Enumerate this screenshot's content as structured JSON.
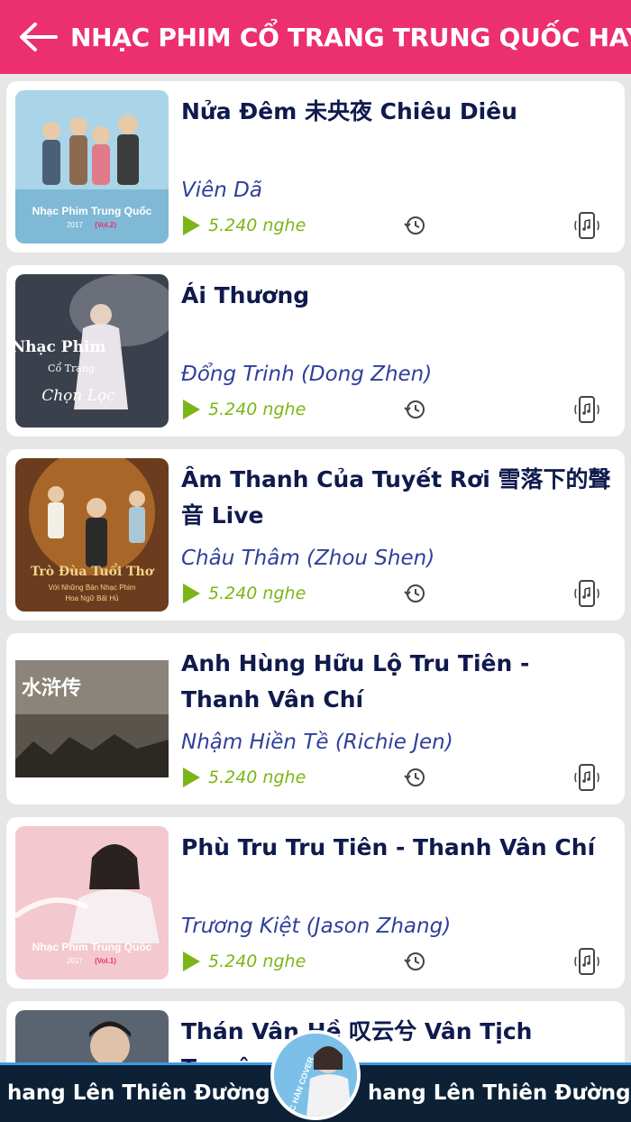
{
  "header": {
    "title": "NHẠC PHIM CỔ TRANG TRUNG QUỐC HAY NHẤT",
    "back_icon": "arrow-left-icon"
  },
  "songs": [
    {
      "title": "Nửa Đêm 未央夜 Chiêu Diêu",
      "artist": "Viên Dã",
      "plays": "5.240 nghe",
      "thumb_text": "Nhạc Phim Trung Quốc",
      "thumb_sub": "2017",
      "thumb_badge": "(Vol.2)"
    },
    {
      "title": "Ái Thương",
      "artist": "Đổng Trinh (Dong Zhen)",
      "plays": "5.240 nghe",
      "thumb_text": "Nhạc Phim",
      "thumb_sub": "Cổ Trang",
      "thumb_badge": "Chọn Lọc"
    },
    {
      "title": "Âm Thanh Của Tuyết Rơi 雪落下的聲音 Live",
      "artist": "Châu Thâm (Zhou Shen)",
      "plays": "5.240 nghe",
      "thumb_text": "Trò Đùa Tuổi Thơ",
      "thumb_sub": "Với Những Bản Nhạc Phim",
      "thumb_badge": "Hoa Ngữ Bất Hủ"
    },
    {
      "title": "Anh Hùng Hữu Lộ Tru Tiên - Thanh Vân Chí",
      "artist": "Nhậm Hiền Tề (Richie Jen)",
      "plays": "5.240 nghe",
      "thumb_text": "水浒传",
      "thumb_sub": "",
      "thumb_badge": ""
    },
    {
      "title": "Phù Tru Tru Tiên - Thanh Vân Chí",
      "artist": "Trương Kiệt (Jason Zhang)",
      "plays": "5.240 nghe",
      "thumb_text": "Nhạc Phim Trung Quốc",
      "thumb_sub": "2017",
      "thumb_badge": "(Vol.1)"
    },
    {
      "title": "Thán Vân Hề 叹云兮 Vân Tịch Truyện",
      "artist": "",
      "plays": "",
      "thumb_text": "",
      "thumb_sub": "",
      "thumb_badge": ""
    }
  ],
  "player": {
    "now_playing": "hang Lên Thiên Đường",
    "disc_label": "NHẠC HÀN COVER"
  },
  "colors": {
    "header": "#ec2f6e",
    "title": "#0f1a4d",
    "artist": "#2f3f9a",
    "plays": "#7cb518",
    "player_bg": "#0c2036"
  }
}
